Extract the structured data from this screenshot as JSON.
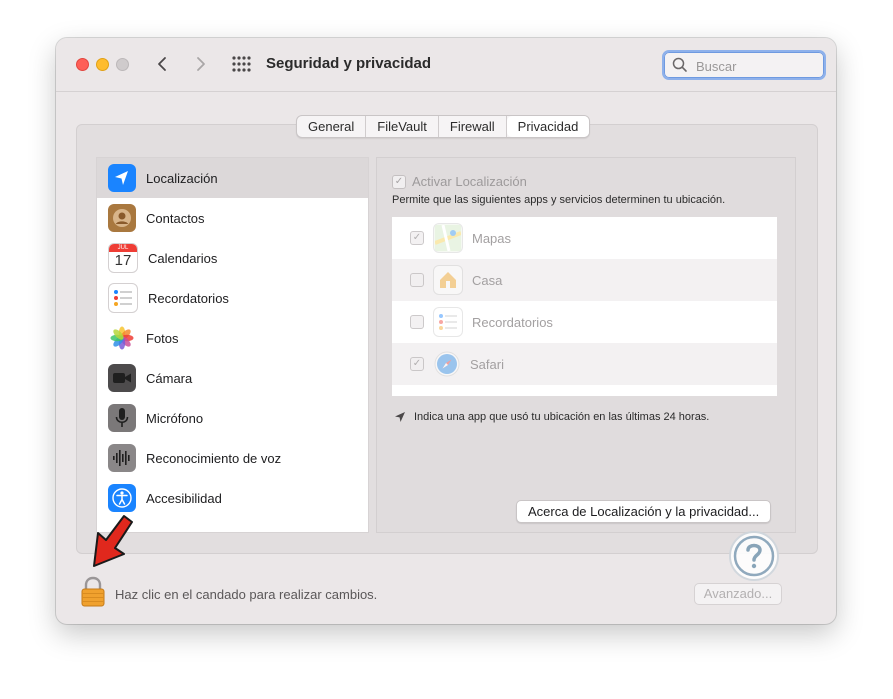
{
  "window": {
    "title": "Seguridad y privacidad",
    "search_placeholder": "Buscar"
  },
  "tabs": [
    {
      "label": "General",
      "active": false
    },
    {
      "label": "FileVault",
      "active": false
    },
    {
      "label": "Firewall",
      "active": false
    },
    {
      "label": "Privacidad",
      "active": true
    }
  ],
  "sidebar": {
    "selected": "Localización",
    "items": [
      {
        "label": "Localización",
        "icon": "location-arrow-icon"
      },
      {
        "label": "Contactos",
        "icon": "contacts-icon"
      },
      {
        "label": "Calendarios",
        "icon": "calendar-icon",
        "icon_month": "JUL",
        "icon_day": "17"
      },
      {
        "label": "Recordatorios",
        "icon": "reminders-icon"
      },
      {
        "label": "Fotos",
        "icon": "photos-icon"
      },
      {
        "label": "Cámara",
        "icon": "camera-icon"
      },
      {
        "label": "Micrófono",
        "icon": "microphone-icon"
      },
      {
        "label": "Reconocimiento de voz",
        "icon": "speech-recognition-icon"
      },
      {
        "label": "Accesibilidad",
        "icon": "accessibility-icon"
      }
    ]
  },
  "detail": {
    "activate_label": "Activar Localización",
    "activate_checked": true,
    "description": "Permite que las siguientes apps y servicios determinen tu ubicación.",
    "apps": [
      {
        "label": "Mapas",
        "checked": true,
        "icon": "maps-icon"
      },
      {
        "label": "Casa",
        "checked": false,
        "icon": "home-icon"
      },
      {
        "label": "Recordatorios",
        "checked": false,
        "icon": "reminders-icon"
      },
      {
        "label": "Safari",
        "checked": true,
        "icon": "safari-icon"
      }
    ],
    "hint": "Indica una app que usó tu ubicación en las últimas 24 horas.",
    "about_button": "Acerca de Localización y la privacidad..."
  },
  "footer": {
    "lock_text": "Haz clic en el candado para realizar cambios.",
    "advanced_button": "Avanzado..."
  },
  "colors": {
    "accent": "#1a84ff",
    "annotation_arrow": "#e0281d",
    "lock": "#f0a12e"
  }
}
